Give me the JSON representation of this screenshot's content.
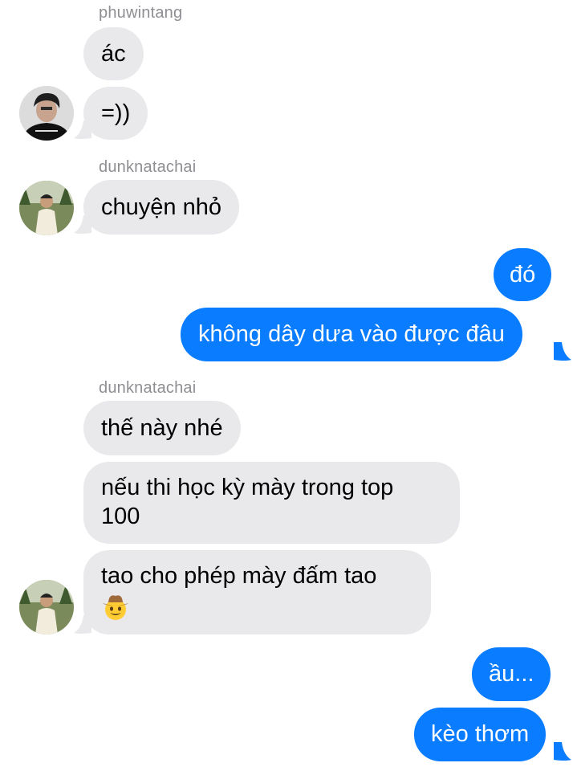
{
  "groups": [
    {
      "sender": "phuwintang",
      "messages": [
        "ác",
        "=))"
      ]
    },
    {
      "sender": "dunknatachai",
      "messages": [
        "chuyện nhỏ"
      ]
    },
    {
      "sender": "me",
      "messages": [
        "đó",
        "không dây dưa vào được đâu"
      ]
    },
    {
      "sender": "dunknatachai",
      "messages": [
        "thế này nhé",
        "nếu thi học kỳ mày trong top",
        "100",
        "tao cho phép mày đấm tao",
        "🤠"
      ]
    },
    {
      "sender": "me",
      "messages": [
        "ầu...",
        "kèo thơm"
      ]
    }
  ],
  "colors": {
    "incoming_bubble": "#e9e9eb",
    "outgoing_bubble": "#0a7cff",
    "sender_name": "#8e8e93"
  },
  "icons": {
    "avatar_1": "avatar-phuwintang",
    "avatar_2": "avatar-dunknatachai"
  }
}
